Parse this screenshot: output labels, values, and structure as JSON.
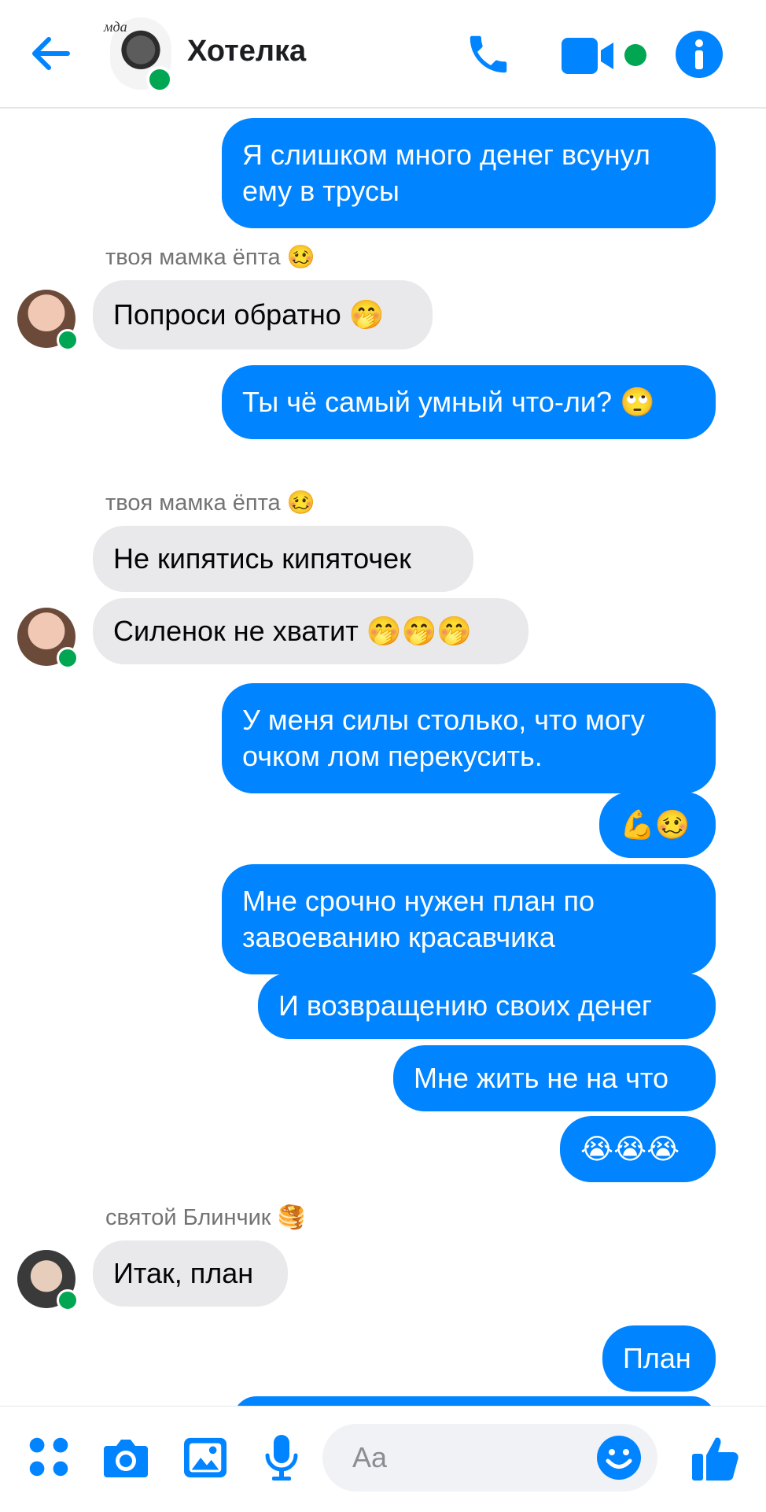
{
  "header": {
    "title": "Хотелка",
    "avatar_caption": "мда"
  },
  "messages": {
    "m1": "Я слишком много денег всунул ему в трусы",
    "sender_mom_1": "твоя мамка ёпта 🥴",
    "m2": "Попроси обратно 🤭",
    "m3": "Ты чё самый умный что-ли? 🙄",
    "sender_mom_2": "твоя мамка ёпта 🥴",
    "m4": "Не кипятись кипяточек",
    "m5": "Силенок не хватит 🤭🤭🤭",
    "m6": "У меня силы столько, что могу очком лом перекусить.",
    "m7": "💪🥴",
    "m8": "Мне срочно нужен план по завоеванию красавчика",
    "m9": "И возвращению своих денег",
    "m10": "Мне жить не на что",
    "m11": "😭😭😭",
    "sender_blin": "святой Блинчик 🥞",
    "m12": "Итак, план",
    "m13": "План"
  },
  "composer": {
    "placeholder": "Aa"
  },
  "colors": {
    "accent": "#0084ff",
    "outgoing_bubble": "#0084ff",
    "incoming_bubble": "#e9e9ec",
    "online": "#00a651"
  },
  "icons": [
    "back-arrow-icon",
    "phone-icon",
    "video-camera-icon",
    "info-icon",
    "menu-dots-icon",
    "camera-icon",
    "image-icon",
    "microphone-icon",
    "emoji-icon",
    "thumbs-up-icon"
  ]
}
